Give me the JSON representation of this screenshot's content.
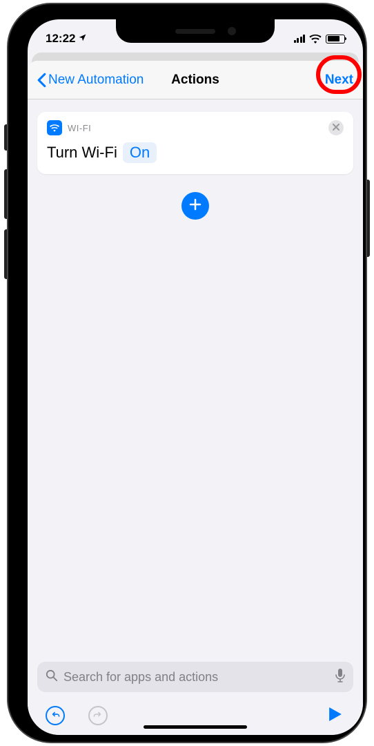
{
  "status": {
    "time": "12:22",
    "location_icon": "location-arrow"
  },
  "nav": {
    "back_label": "New Automation",
    "title": "Actions",
    "next_label": "Next"
  },
  "action": {
    "app_label": "WI-FI",
    "action_text": "Turn Wi-Fi",
    "param_value": "On"
  },
  "search": {
    "placeholder": "Search for apps and actions"
  }
}
